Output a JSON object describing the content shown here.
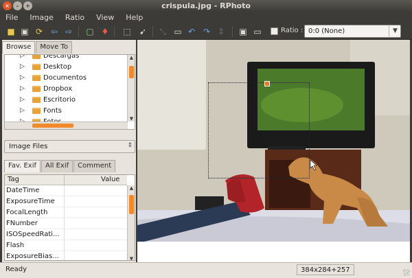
{
  "window": {
    "title": "crispula.jpg - RPhoto"
  },
  "menu": [
    "File",
    "Image",
    "Ratio",
    "View",
    "Help"
  ],
  "toolbar": {
    "ratio_label": "Ratio :",
    "ratio_value": "0:0 (None)"
  },
  "left_tabs": {
    "browse": "Browse",
    "move_to": "Move To"
  },
  "folders": [
    "Descargas",
    "Desktop",
    "Documentos",
    "Dropbox",
    "Escritorio",
    "Fonts",
    "Fotos"
  ],
  "filter": {
    "value": "Image Files"
  },
  "exif_tabs": {
    "fav": "Fav. Exif",
    "all": "All Exif",
    "comment": "Comment"
  },
  "exif_table": {
    "columns": [
      "Tag",
      "Value"
    ],
    "rows": [
      "DateTime",
      "ExposureTime",
      "FocalLength",
      "FNumber",
      "ISOSpeedRati...",
      "Flash",
      "ExposureBias..."
    ]
  },
  "status": {
    "left": "Ready",
    "right": "384x284+257"
  },
  "colors": {
    "chrome": "#3c3b37",
    "accent": "#f08a2a",
    "panel": "#e8e4dd"
  }
}
